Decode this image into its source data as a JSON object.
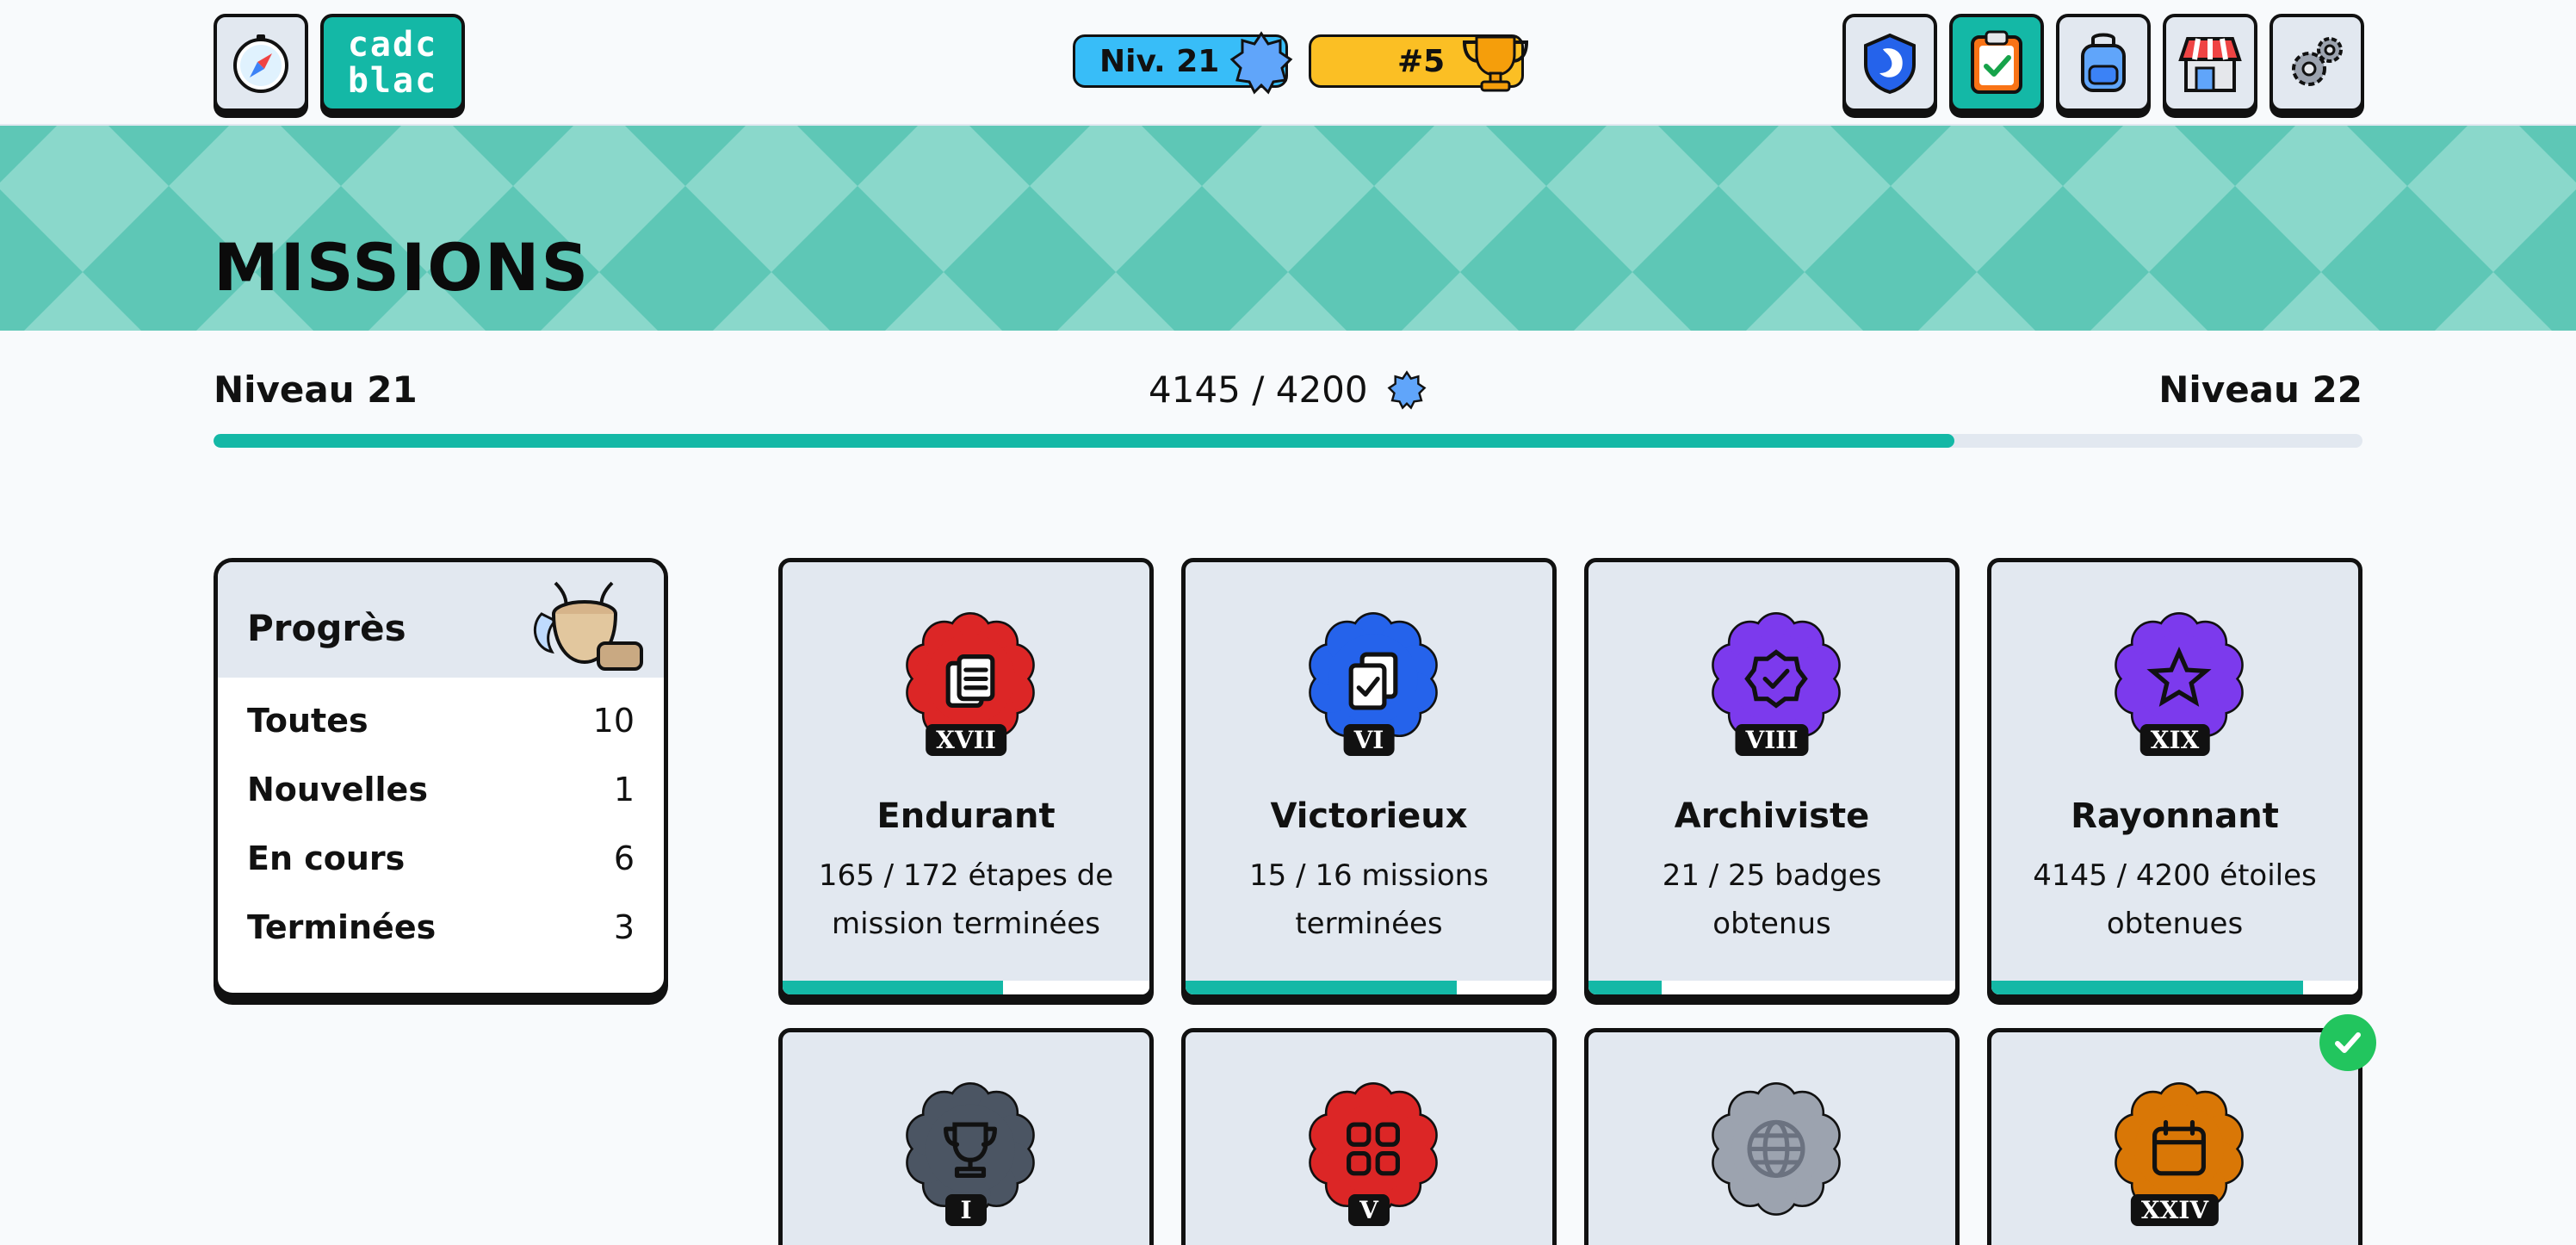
{
  "header": {
    "logo_line1": "cadc",
    "logo_line2": "blac",
    "level_pill": "Niv. 21",
    "rank_pill": "#5",
    "left_icons": [
      "compass-icon"
    ],
    "right_icons": [
      "shield-icon",
      "clipboard-check-icon",
      "backpack-icon",
      "shop-icon",
      "gears-icon"
    ]
  },
  "banner": {
    "title": "MISSIONS"
  },
  "level_progress": {
    "current_label": "Niveau 21",
    "next_label": "Niveau 22",
    "value_text": "4145 / 4200",
    "fraction": 0.81
  },
  "filter_panel": {
    "title": "Progrès",
    "rows": [
      {
        "label": "Toutes",
        "count": "10"
      },
      {
        "label": "Nouvelles",
        "count": "1"
      },
      {
        "label": "En cours",
        "count": "6"
      },
      {
        "label": "Terminées",
        "count": "3"
      }
    ]
  },
  "missions": [
    {
      "name": "Endurant",
      "roman": "XVII",
      "desc": "165 / 172 étapes de mission terminées",
      "progress": 0.6,
      "color": "#dc2626",
      "icon": "clipboard-list-icon"
    },
    {
      "name": "Victorieux",
      "roman": "VI",
      "desc": "15 / 16 missions terminées",
      "progress": 0.74,
      "color": "#2563eb",
      "icon": "clipboard-stack-icon"
    },
    {
      "name": "Archiviste",
      "roman": "VIII",
      "desc": "21 / 25 badges obtenus",
      "progress": 0.2,
      "color": "#7c3aed",
      "icon": "badge-check-icon"
    },
    {
      "name": "Rayonnant",
      "roman": "XIX",
      "desc": "4145 / 4200 étoiles obtenues",
      "progress": 0.85,
      "color": "#7c3aed",
      "icon": "star-icon"
    },
    {
      "name": "",
      "roman": "I",
      "desc": "",
      "progress": null,
      "color": "#4b5563",
      "icon": "trophy-icon"
    },
    {
      "name": "",
      "roman": "V",
      "desc": "",
      "progress": null,
      "color": "#dc2626",
      "icon": "grid-icon"
    },
    {
      "name": "",
      "roman": "",
      "desc": "",
      "progress": null,
      "color": "#9ca3af",
      "icon": "globe-icon"
    },
    {
      "name": "",
      "roman": "XXIV",
      "desc": "",
      "progress": null,
      "color": "#d97706",
      "icon": "calendar-icon",
      "completed": true
    }
  ],
  "colors": {
    "accent": "#14b8a6",
    "banner": "#5ec7b6",
    "ink": "#111111"
  }
}
